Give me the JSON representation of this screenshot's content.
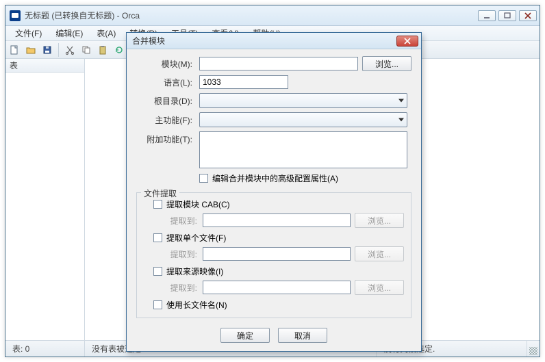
{
  "app": {
    "title": "无标题 (已转换自无标题) - Orca"
  },
  "menus": {
    "file": "文件(F)",
    "edit": "编辑(E)",
    "tables": "表(A)",
    "transform": "转换(R)",
    "tools": "工具(T)",
    "view": "查看(V)",
    "help": "帮助(H)"
  },
  "panes": {
    "left_header": "表"
  },
  "status": {
    "table_count": "表: 0",
    "no_table_selected": "没有表被选定.",
    "no_column_selected": "没有列被选定."
  },
  "dialog": {
    "title": "合并模块",
    "labels": {
      "module": "模块(M):",
      "language": "语言(L):",
      "root_dir": "根目录(D):",
      "main_feature": "主功能(F):",
      "add_features": "附加功能(T):"
    },
    "module_value": "",
    "language_value": "1033",
    "advanced_chk": "编辑合并模块中的高级配置属性(A)",
    "browse": "浏览...",
    "file_extract": {
      "legend": "文件提取",
      "extract_cab": "提取模块 CAB(C)",
      "extract_single": "提取单个文件(F)",
      "extract_source": "提取来源映像(I)",
      "use_long_names": "使用长文件名(N)",
      "extract_to": "提取到:",
      "browse": "浏览..."
    },
    "buttons": {
      "ok": "确定",
      "cancel": "取消"
    }
  }
}
